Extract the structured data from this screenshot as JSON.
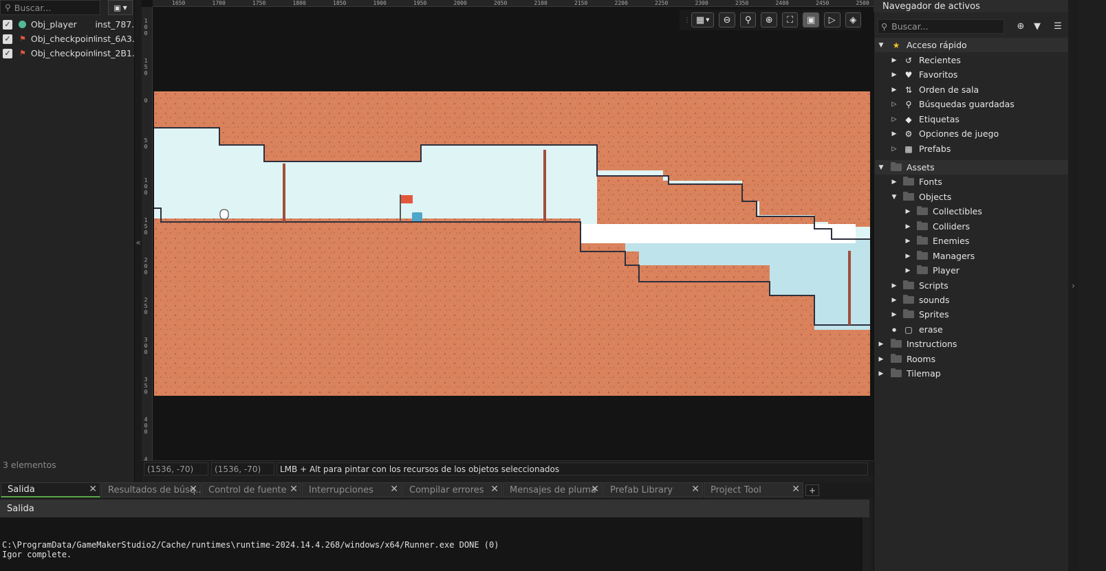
{
  "instances": {
    "search_placeholder": "Buscar...",
    "items": [
      {
        "object": "Obj_player",
        "instance": "inst_787...",
        "checked": true,
        "icon": "player-object-icon"
      },
      {
        "object": "Obj_checkpoint",
        "instance": "inst_6A3...",
        "checked": true,
        "icon": "flag-icon"
      },
      {
        "object": "Obj_checkpoint",
        "instance": "inst_2B1...",
        "checked": true,
        "icon": "flag-icon"
      }
    ],
    "count_label": "3 elementos"
  },
  "ruler": {
    "top_ticks": [
      "1650",
      "1700",
      "1750",
      "1800",
      "1850",
      "1900",
      "1950",
      "2000",
      "2050",
      "2100",
      "2150",
      "2200",
      "2250",
      "2300",
      "2350",
      "2400",
      "2450",
      "2500"
    ],
    "left_ticks": [
      "100",
      "150",
      "0",
      "50",
      "100",
      "150",
      "200",
      "250",
      "300",
      "350",
      "400",
      "4"
    ]
  },
  "room_toolbar": [
    "grid-icon",
    "zoom-out-icon",
    "zoom-reset-icon",
    "zoom-in-icon",
    "fit-icon",
    "frame-icon",
    "play-icon",
    "layers-icon"
  ],
  "status": {
    "cursor_pos": "(1536, -70)",
    "snap_pos": "(1536, -70)",
    "hint": "LMB + Alt para pintar con los recursos de los objetos seleccionados"
  },
  "asset_browser": {
    "title": "Navegador de activos",
    "search_placeholder": "Buscar...",
    "quick_access": {
      "label": "Acceso rápido",
      "items": [
        {
          "label": "Recientes",
          "icon": "history-icon"
        },
        {
          "label": "Favoritos",
          "icon": "heart-icon"
        },
        {
          "label": "Orden de sala",
          "icon": "sort-icon"
        },
        {
          "label": "Búsquedas guardadas",
          "icon": "search-icon"
        },
        {
          "label": "Etiquetas",
          "icon": "tag-icon"
        },
        {
          "label": "Opciones de juego",
          "icon": "gear-icon"
        },
        {
          "label": "Prefabs",
          "icon": "prefab-icon"
        }
      ]
    },
    "assets": {
      "label": "Assets",
      "children": [
        "Fonts",
        "Objects",
        "Scripts",
        "sounds",
        "Sprites",
        "erase"
      ],
      "objects_children": [
        "Collectibles",
        "Colliders",
        "Enemies",
        "Managers",
        "Player"
      ]
    },
    "root_folders": [
      "Instructions",
      "Rooms",
      "Tilemap"
    ]
  },
  "output": {
    "tabs": [
      "Salida",
      "Resultados de búsq...",
      "Control de fuente",
      "Interrupciones",
      "Compilar errores",
      "Mensajes de pluma",
      "Prefab Library",
      "Project Tool"
    ],
    "active_tab": "Salida",
    "header": "Salida",
    "lines": [
      "C:\\ProgramData/GameMakerStudio2/Cache/runtimes\\runtime-2024.14.4.268/windows/x64/Runner.exe DONE (0)",
      "Igor complete."
    ]
  },
  "colors": {
    "accent": "#5ca84a",
    "dirt": "#d9825c",
    "sky": "#dff4f4",
    "water": "#bfe3ea"
  }
}
